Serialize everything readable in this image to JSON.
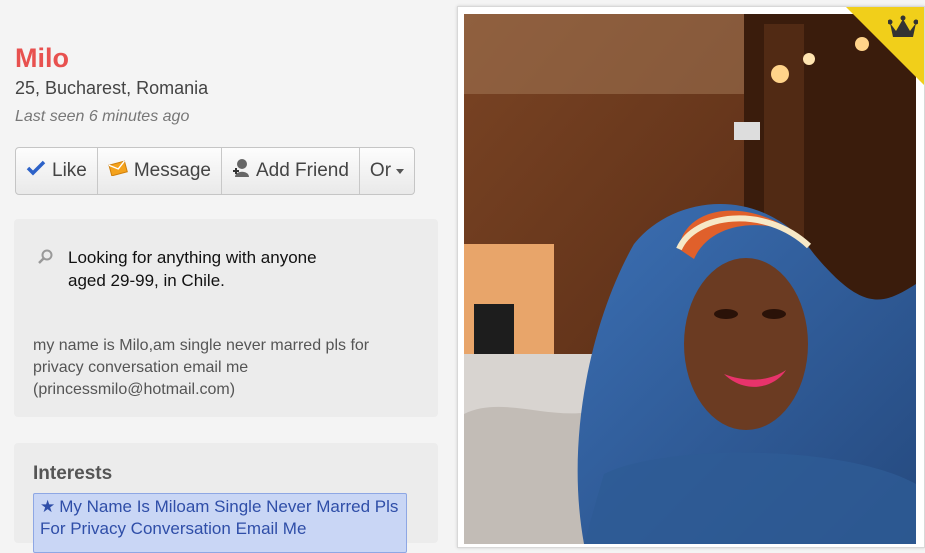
{
  "profile": {
    "name": "Milo",
    "location": "25, Bucharest, Romania",
    "last_seen": "Last seen 6 minutes ago"
  },
  "actions": {
    "like": "Like",
    "message": "Message",
    "add_friend": "Add Friend",
    "or": "Or"
  },
  "looking_for": {
    "line1": "Looking for anything with anyone",
    "line2": "aged 29-99, in Chile."
  },
  "about": "my name is Milo,am single never marred pls for privacy conversation email me (princessmilo@hotmail.com)",
  "interests": {
    "title": "Interests",
    "items": [
      "My Name Is Miloam Single Never Marred Pls For Privacy Conversation Email Me"
    ]
  },
  "icons": {
    "like": "checkmark-icon",
    "message": "envelope-icon",
    "add_friend": "person-add-icon",
    "search": "magnifier-icon",
    "interest": "star-icon",
    "premium": "crown-icon"
  },
  "colors": {
    "name": "#e8514f",
    "premium_badge": "#f1cf1a",
    "interest_bg": "#c9d6f5"
  }
}
